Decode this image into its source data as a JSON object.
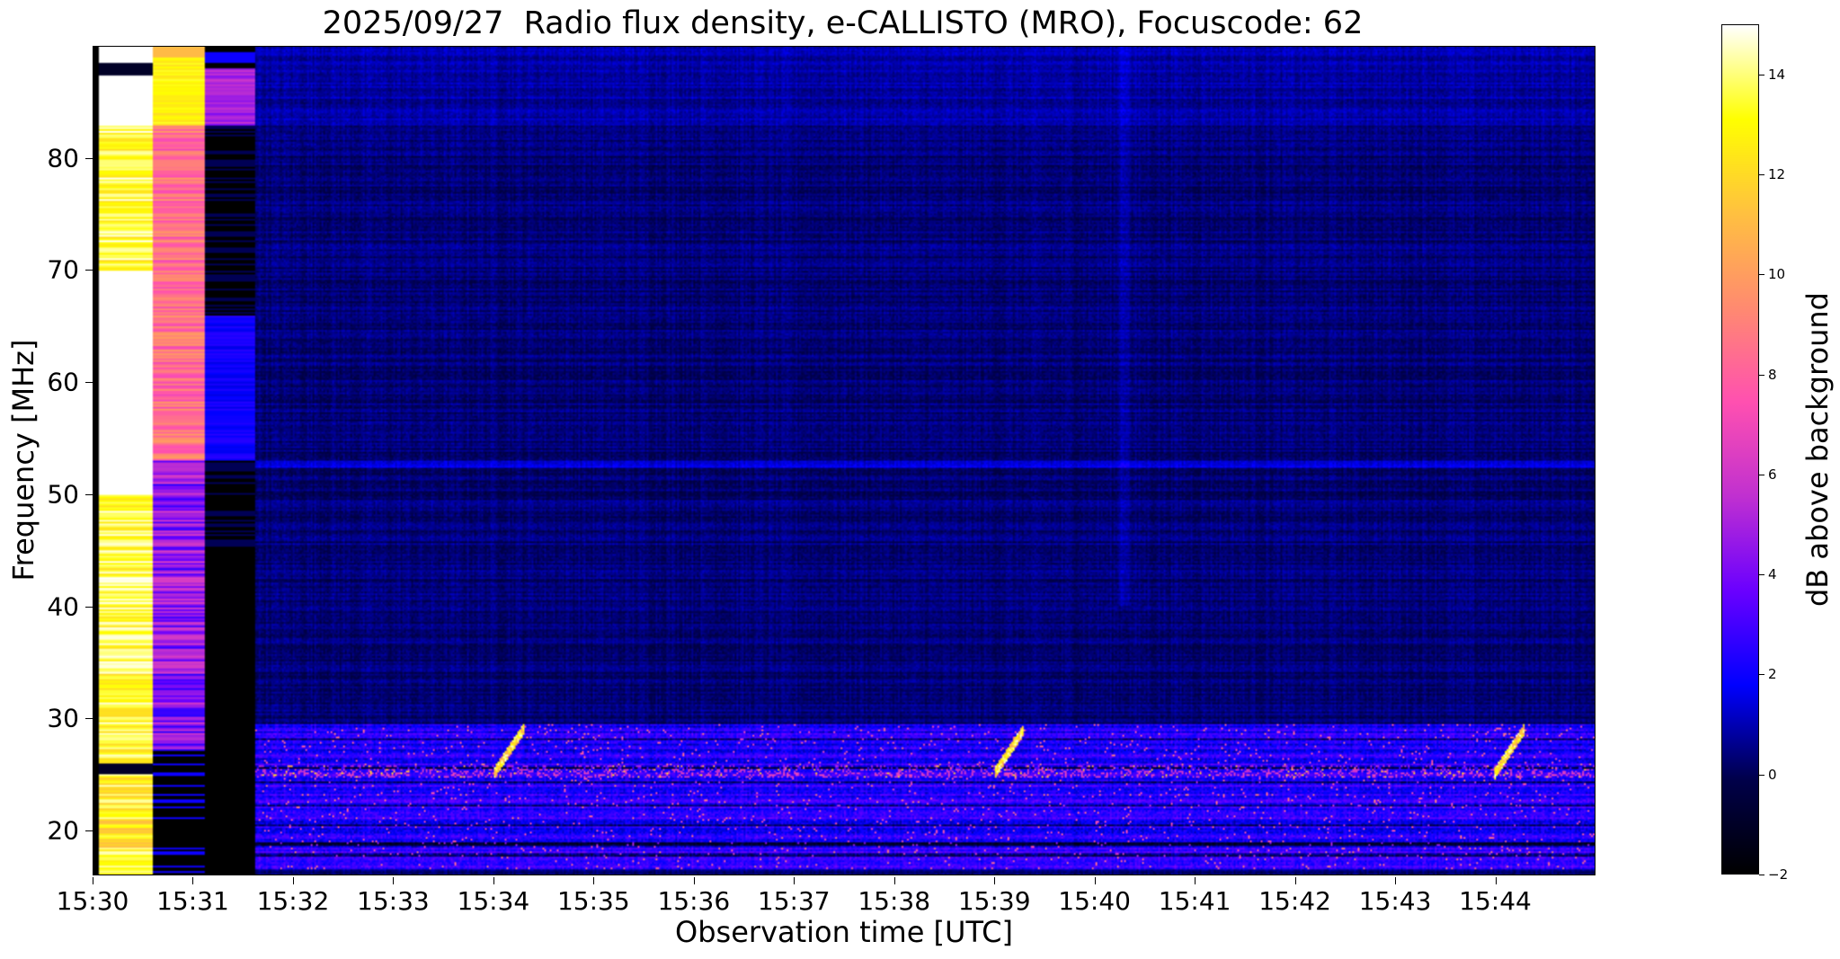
{
  "chart_data": {
    "type": "heatmap",
    "title": "2025/09/27  Radio flux density, e-CALLISTO (MRO), Focuscode: 62",
    "xlabel": "Observation time [UTC]",
    "ylabel": "Frequency [MHz]",
    "xlim": [
      "15:30",
      "15:45"
    ],
    "ylim": [
      16,
      90
    ],
    "x_ticks": [
      "15:30",
      "15:31",
      "15:32",
      "15:33",
      "15:34",
      "15:35",
      "15:36",
      "15:37",
      "15:38",
      "15:39",
      "15:40",
      "15:41",
      "15:42",
      "15:43",
      "15:44"
    ],
    "y_ticks": [
      20,
      30,
      40,
      50,
      60,
      70,
      80
    ],
    "colorbar": {
      "label": "dB above background",
      "range": [
        -2,
        15
      ],
      "ticks": [
        -2,
        0,
        2,
        4,
        6,
        8,
        10,
        12,
        14
      ],
      "colormap": "gnuplot2",
      "colors": [
        "#000000",
        "#00004a",
        "#0000ff",
        "#6a00ff",
        "#c030d0",
        "#ff50b0",
        "#ff8a70",
        "#ffc040",
        "#ffff00",
        "#ffffff"
      ]
    },
    "features": [
      {
        "time": "15:34",
        "freq_range": [
          25,
          29
        ]
      },
      {
        "time": "15:39",
        "freq_range": [
          25,
          29
        ]
      },
      {
        "time": "15:44",
        "freq_range": [
          25,
          29
        ]
      }
    ]
  }
}
